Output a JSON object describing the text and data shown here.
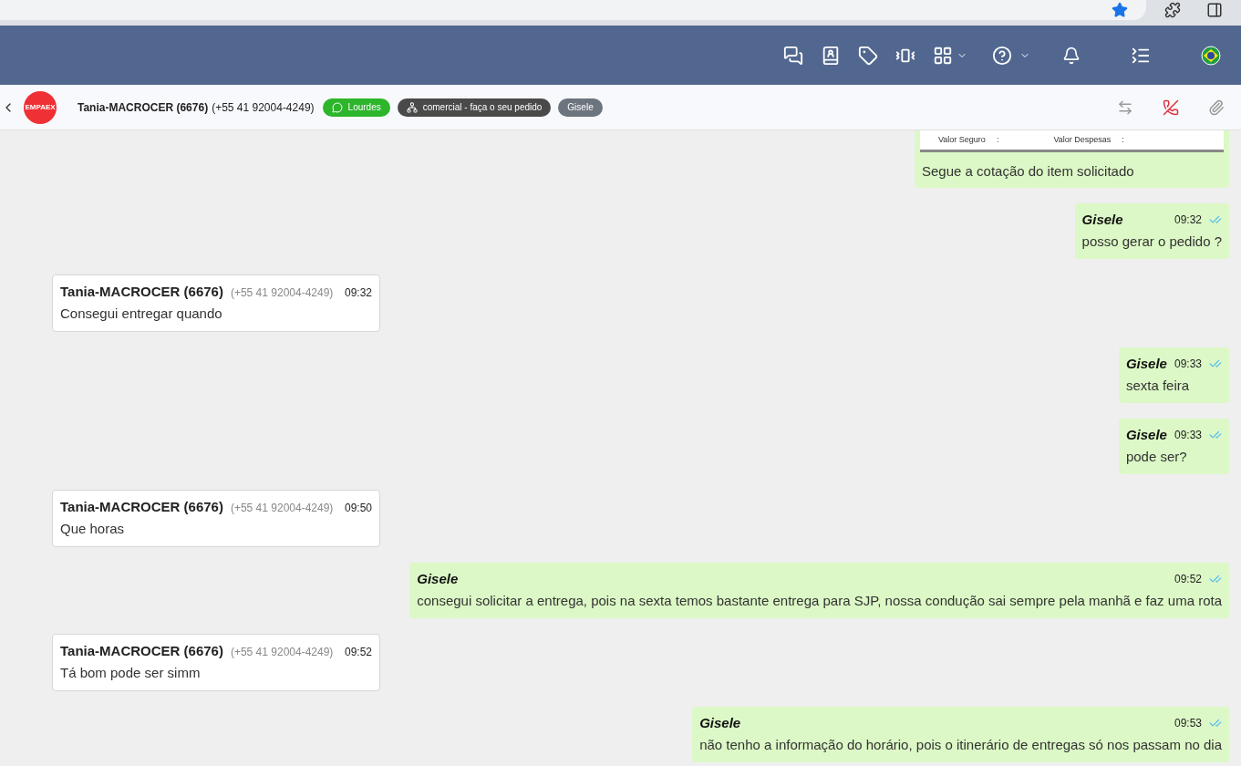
{
  "contact": {
    "logo_text": "EMPAEX",
    "name": "Tania-MACROCER (6676)",
    "phone": "(+55 41 92004-4249)"
  },
  "tags": [
    {
      "kind": "whatsapp",
      "label": "Lourdes",
      "color": "#2db52b"
    },
    {
      "kind": "queue",
      "label": "comercial - faça o seu pedido",
      "color": "#4a4a4a"
    },
    {
      "kind": "user",
      "label": "Gisele",
      "color": "#6c757d"
    }
  ],
  "messages": [
    {
      "kind": "document",
      "labels": [
        "Valor Seguro",
        ":",
        "Valor Despesas",
        ":"
      ],
      "text": "Segue a cotação do item solicitado"
    },
    {
      "kind": "outgoing",
      "sender": "Gisele",
      "time": "09:32",
      "text": "posso gerar o pedido ?"
    },
    {
      "kind": "incoming",
      "sender": "Tania-MACROCER (6676)",
      "phone": "(+55 41 92004-4249)",
      "time": "09:32",
      "text": "Consegui entregar quando"
    },
    {
      "kind": "outgoing",
      "sender": "Gisele",
      "time": "09:33",
      "text": "sexta feira"
    },
    {
      "kind": "outgoing",
      "sender": "Gisele",
      "time": "09:33",
      "text": "pode ser?"
    },
    {
      "kind": "incoming",
      "sender": "Tania-MACROCER (6676)",
      "phone": "(+55 41 92004-4249)",
      "time": "09:50",
      "text": "Que horas"
    },
    {
      "kind": "outgoing",
      "sender": "Gisele",
      "time": "09:52",
      "text": "consegui solicitar a entrega, pois na sexta temos bastante entrega para SJP, nossa condução sai sempre pela manhã e faz uma rota"
    },
    {
      "kind": "incoming",
      "sender": "Tania-MACROCER (6676)",
      "phone": "(+55 41 92004-4249)",
      "time": "09:52",
      "text": "Tá bom pode ser simm"
    },
    {
      "kind": "outgoing",
      "sender": "Gisele",
      "time": "09:53",
      "text": "não tenho a informação do horário, pois o itinerário de entregas só nos passam no dia"
    }
  ]
}
